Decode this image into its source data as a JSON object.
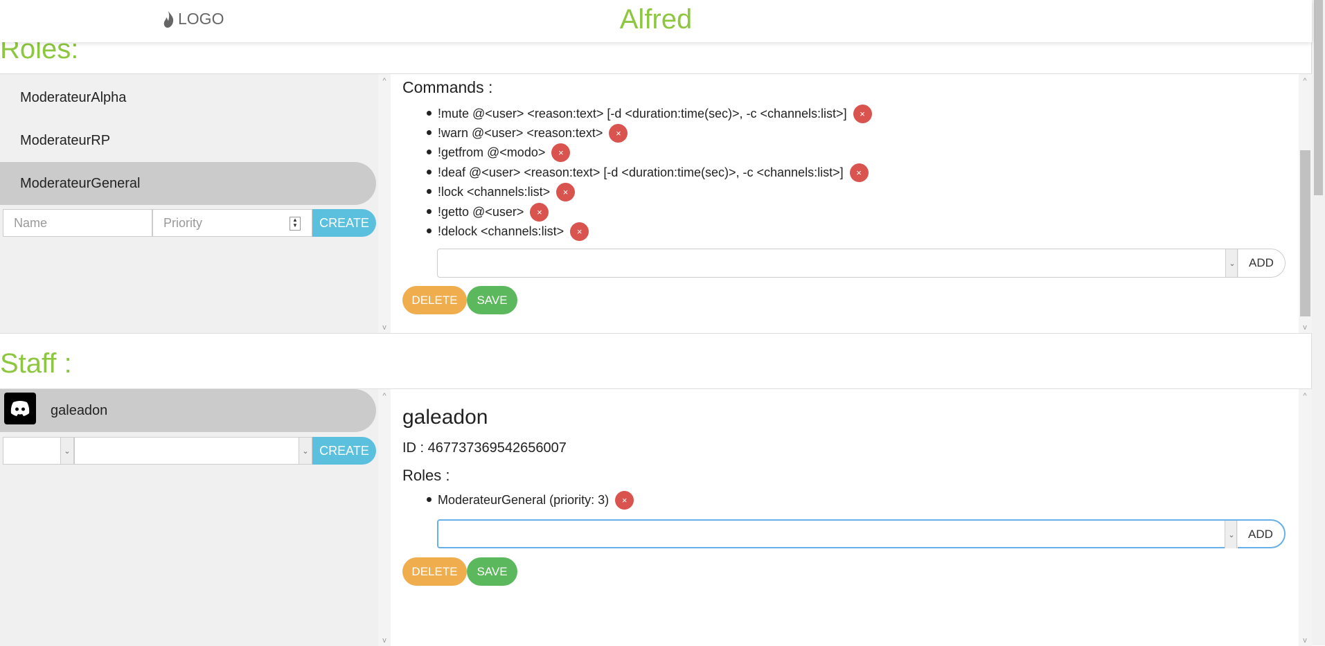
{
  "header": {
    "logo_text": "LOGO",
    "logo_icon": "flame-icon",
    "app_title": "Alfred"
  },
  "roles": {
    "section_title": "Roles:",
    "items": [
      {
        "label": "ModerateurAlpha",
        "active": false
      },
      {
        "label": "ModerateurRP",
        "active": false
      },
      {
        "label": "ModerateurGeneral",
        "active": true
      }
    ],
    "create_form": {
      "name_placeholder": "Name",
      "priority_placeholder": "Priority",
      "create_label": "CREATE"
    },
    "detail": {
      "commands_title": "Commands :",
      "commands": [
        "!mute @<user> <reason:text> [-d <duration:time(sec)>, -c <channels:list>]",
        "!warn @<user> <reason:text>",
        "!getfrom @<modo>",
        "!deaf @<user> <reason:text> [-d <duration:time(sec)>, -c <channels:list>]",
        "!lock <channels:list>",
        "!getto @<user>",
        "!delock <channels:list>"
      ],
      "remove_symbol": "×",
      "add_label": "ADD",
      "delete_label": "DELETE",
      "save_label": "SAVE"
    }
  },
  "staff": {
    "section_title": "Staff :",
    "items": [
      {
        "label": "galeadon",
        "avatar": "discord-icon",
        "active": true
      }
    ],
    "create_label": "CREATE",
    "detail": {
      "name": "galeadon",
      "id_text": "ID : 467737369542656007",
      "roles_title": "Roles :",
      "roles": [
        "ModerateurGeneral (priority: 3)"
      ],
      "remove_symbol": "×",
      "add_label": "ADD",
      "delete_label": "DELETE",
      "save_label": "SAVE"
    }
  },
  "colors": {
    "accent": "#8dc63f",
    "danger": "#d9534f",
    "warning": "#f0ad4e",
    "success": "#5cb85c",
    "info": "#5bc0de"
  }
}
